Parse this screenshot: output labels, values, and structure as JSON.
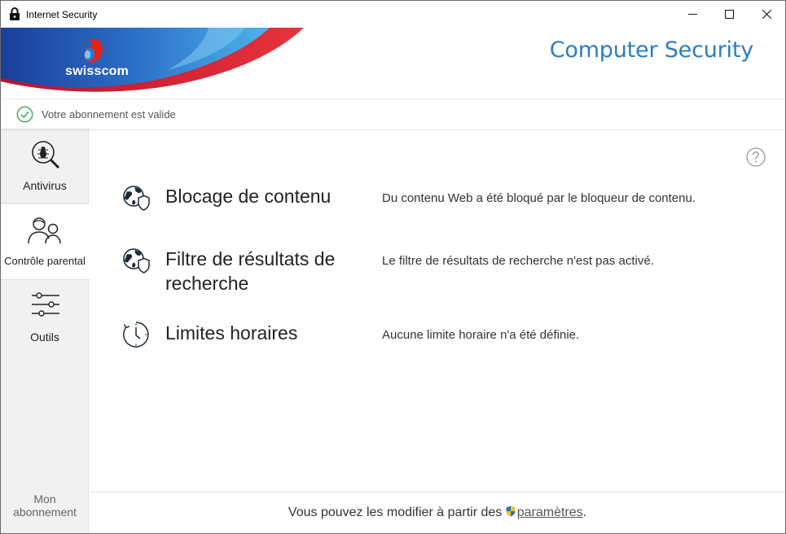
{
  "window": {
    "title": "Internet Security"
  },
  "banner": {
    "brand": "swisscom",
    "product": "Computer Security"
  },
  "status": {
    "text": "Votre abonnement est valide"
  },
  "sidebar": {
    "items": [
      {
        "label": "Antivirus",
        "icon": "bug-search-icon"
      },
      {
        "label": "Contrôle parental",
        "icon": "parent-child-icon"
      },
      {
        "label": "Outils",
        "icon": "sliders-icon"
      }
    ],
    "subscription_line1": "Mon",
    "subscription_line2": "abonnement"
  },
  "features": [
    {
      "name": "Blocage de contenu",
      "description": "Du contenu Web a été bloqué par le bloqueur de contenu.",
      "icon": "globe-shield-icon"
    },
    {
      "name": "Filtre de résultats de recherche",
      "description": "Le filtre de résultats de recherche n'est pas activé.",
      "icon": "globe-shield-icon"
    },
    {
      "name": "Limites horaires",
      "description": "Aucune limite horaire n'a été définie.",
      "icon": "clock-icon"
    }
  ],
  "footer": {
    "text": "Vous pouvez les modifier à partir des ",
    "link": "paramètres",
    "suffix": "."
  },
  "colors": {
    "accent": "#2a7ec0",
    "brand_blue": "#1b4fa8",
    "brand_red": "#e2231a",
    "status_green": "#3aa655"
  }
}
